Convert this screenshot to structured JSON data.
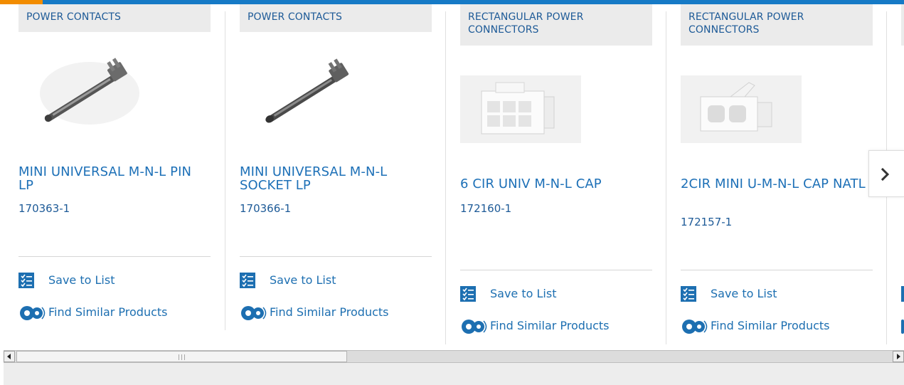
{
  "cards": [
    {
      "category": "POWER CONTACTS",
      "title": "MINI UNIVERSAL M-N-L PIN LP",
      "part_number": "170363-1",
      "save_label": "Save to List",
      "similar_label": "Find Similar Products"
    },
    {
      "category": "POWER CONTACTS",
      "title": "MINI UNIVERSAL M-N-L SOCKET LP",
      "part_number": "170366-1",
      "save_label": "Save to List",
      "similar_label": "Find Similar Products"
    },
    {
      "category": "RECTANGULAR POWER CONNECTORS",
      "title": "6 CIR UNIV M-N-L CAP",
      "part_number": "172160-1",
      "save_label": "Save to List",
      "similar_label": "Find Similar Products"
    },
    {
      "category": "RECTANGULAR POWER CONNECTORS",
      "title": "2CIR MINI U-M-N-L CAP NATL",
      "part_number": "172157-1",
      "save_label": "Save to List",
      "similar_label": "Find Similar Products"
    }
  ],
  "colors": {
    "accent_blue": "#167ac6",
    "accent_orange": "#f28c00",
    "link_blue": "#1d70b7",
    "category_bg": "#ebebeb"
  },
  "icons": {
    "save": "checklist-icon",
    "similar": "gears-icon",
    "next": "chevron-right-icon"
  },
  "scroll": {
    "horizontal_position": 0
  }
}
